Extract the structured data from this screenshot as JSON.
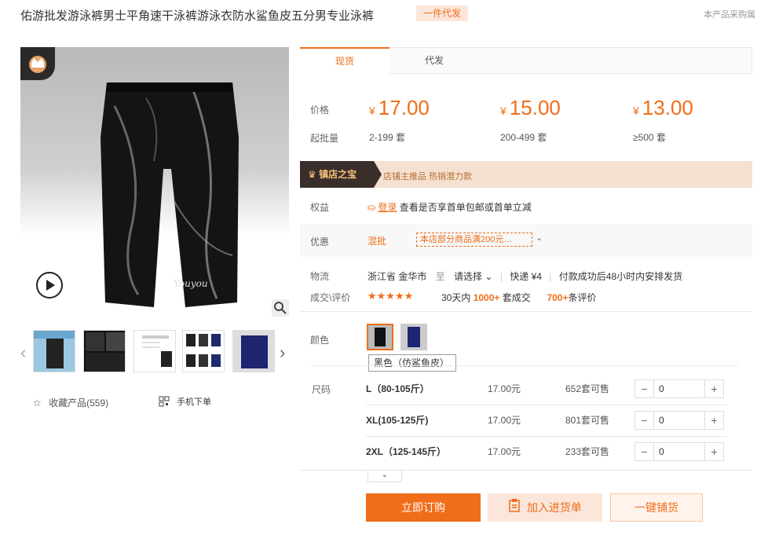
{
  "header": {
    "title": "佑游批发游泳裤男士平角速干泳裤游泳衣防水鲨鱼皮五分男专业泳裤",
    "badge": "一件代发",
    "right_note": "本产品采购属"
  },
  "gallery": {
    "favorite_label": "收藏产品(559)",
    "mobile_order_label": "手机下单",
    "brand_text": "Youyou"
  },
  "tabs": [
    "现货",
    "代发"
  ],
  "pricing": {
    "price_label": "价格",
    "moq_label": "起批量",
    "currency": "¥",
    "tiers": [
      {
        "price": "17.00",
        "range": "2-199",
        "unit": "套"
      },
      {
        "price": "15.00",
        "range": "200-499",
        "unit": "套"
      },
      {
        "price": "13.00",
        "range": "≥500",
        "unit": "套"
      }
    ]
  },
  "shop_banner": {
    "title": "镇店之宝",
    "text": "店铺主推品  热销潜力款"
  },
  "benefits": {
    "label": "权益",
    "login_link": "登录",
    "text": "查看是否享首单包邮或首单立减"
  },
  "discount": {
    "label": "优惠",
    "mixed_batch": "混批",
    "promo": "本店部分商品满200元…"
  },
  "logistics": {
    "label": "物流",
    "origin": "浙江省 金华市",
    "to": "至",
    "destination": "请选择",
    "shipping": "快递 ¥4",
    "ship_time": "付款成功后48小时内安排发货"
  },
  "reviews": {
    "label": "成交\\评价",
    "stars": "★★★★★",
    "period": "30天内",
    "deals": "1000+",
    "deals_suffix": "套成交",
    "reviews": "700+",
    "reviews_suffix": "条评价"
  },
  "color": {
    "label": "颜色",
    "selected_name": "黑色（仿鲨鱼皮）"
  },
  "sizes": {
    "label": "尺码",
    "stock_suffix": "套可售",
    "rows": [
      {
        "name": "L（80-105斤）",
        "price": "17.00元",
        "stock": "652",
        "qty": "0"
      },
      {
        "name": "XL(105-125斤)",
        "price": "17.00元",
        "stock": "801",
        "qty": "0"
      },
      {
        "name": "2XL（125-145斤）",
        "price": "17.00元",
        "stock": "233",
        "qty": "0"
      }
    ]
  },
  "actions": {
    "buy_now": "立即订购",
    "add_list": "加入进货单",
    "one_click": "一键铺货"
  },
  "colors": {
    "accent": "#f06d19",
    "banner_bg": "#f5e1d2"
  }
}
